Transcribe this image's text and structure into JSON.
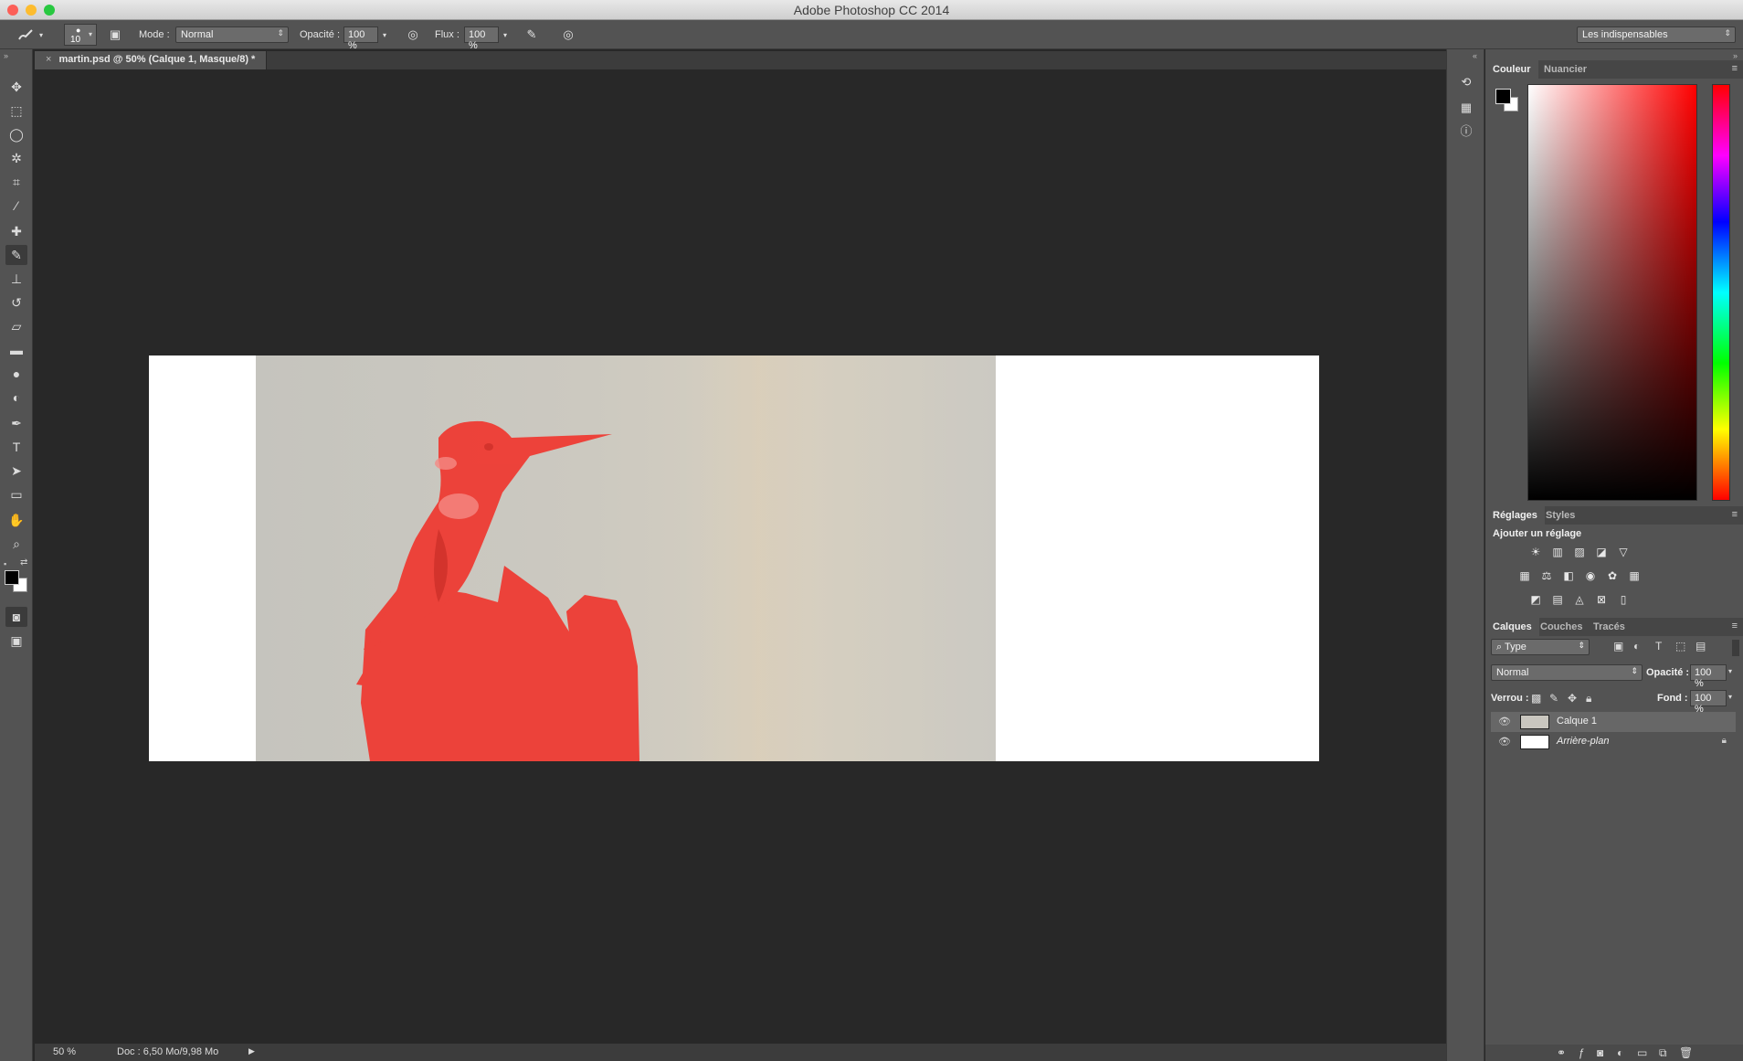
{
  "window": {
    "title": "Adobe Photoshop CC 2014"
  },
  "options_bar": {
    "brush_size": "10",
    "mode_label": "Mode :",
    "mode_value": "Normal",
    "opacity_label": "Opacité :",
    "opacity_value": "100 %",
    "flow_label": "Flux :",
    "flow_value": "100 %",
    "workspace_value": "Les indispensables"
  },
  "document": {
    "tab_title": "martin.psd @ 50% (Calque 1, Masque/8) *",
    "close_glyph": "×"
  },
  "status_bar": {
    "zoom": "50 %",
    "doc_size": "Doc : 6,50 Mo/9,98 Mo"
  },
  "color_panel": {
    "tabs": [
      "Couleur",
      "Nuancier"
    ],
    "foreground": "#000000",
    "background": "#ffffff",
    "hue_color": "#ff0000"
  },
  "adjustments_panel": {
    "tabs": [
      "Réglages",
      "Styles"
    ],
    "heading": "Ajouter un réglage"
  },
  "layers_panel": {
    "tabs": [
      "Calques",
      "Couches",
      "Tracés"
    ],
    "filter_value": "Type",
    "blend_mode": "Normal",
    "opacity_label": "Opacité :",
    "opacity_value": "100 %",
    "lock_label": "Verrou :",
    "fill_label": "Fond :",
    "fill_value": "100 %",
    "layers": [
      {
        "name": "Calque 1",
        "selected": true
      },
      {
        "name": "Arrière-plan",
        "selected": false
      }
    ]
  },
  "colors": {
    "mask_overlay": "#ee3b33",
    "workspace_bg": "#282828",
    "panel_bg": "#535353"
  }
}
